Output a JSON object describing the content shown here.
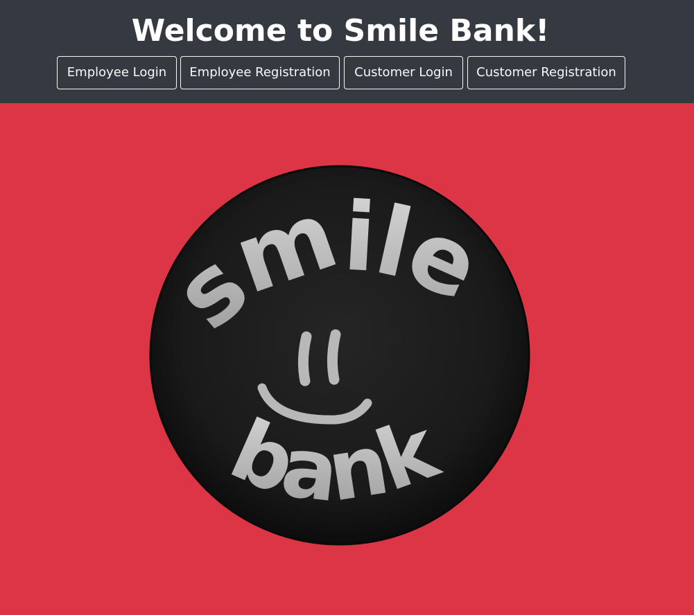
{
  "header": {
    "title": "Welcome to Smile Bank!",
    "nav": {
      "employee_login": "Employee Login",
      "employee_registration": "Employee Registration",
      "customer_login": "Customer Login",
      "customer_registration": "Customer Registration"
    },
    "background_color": "#343a40"
  },
  "main": {
    "background_color": "#dc3545",
    "logo": {
      "top_word": "smile",
      "bottom_word": "bank",
      "icon": "smiley-face-icon"
    }
  }
}
